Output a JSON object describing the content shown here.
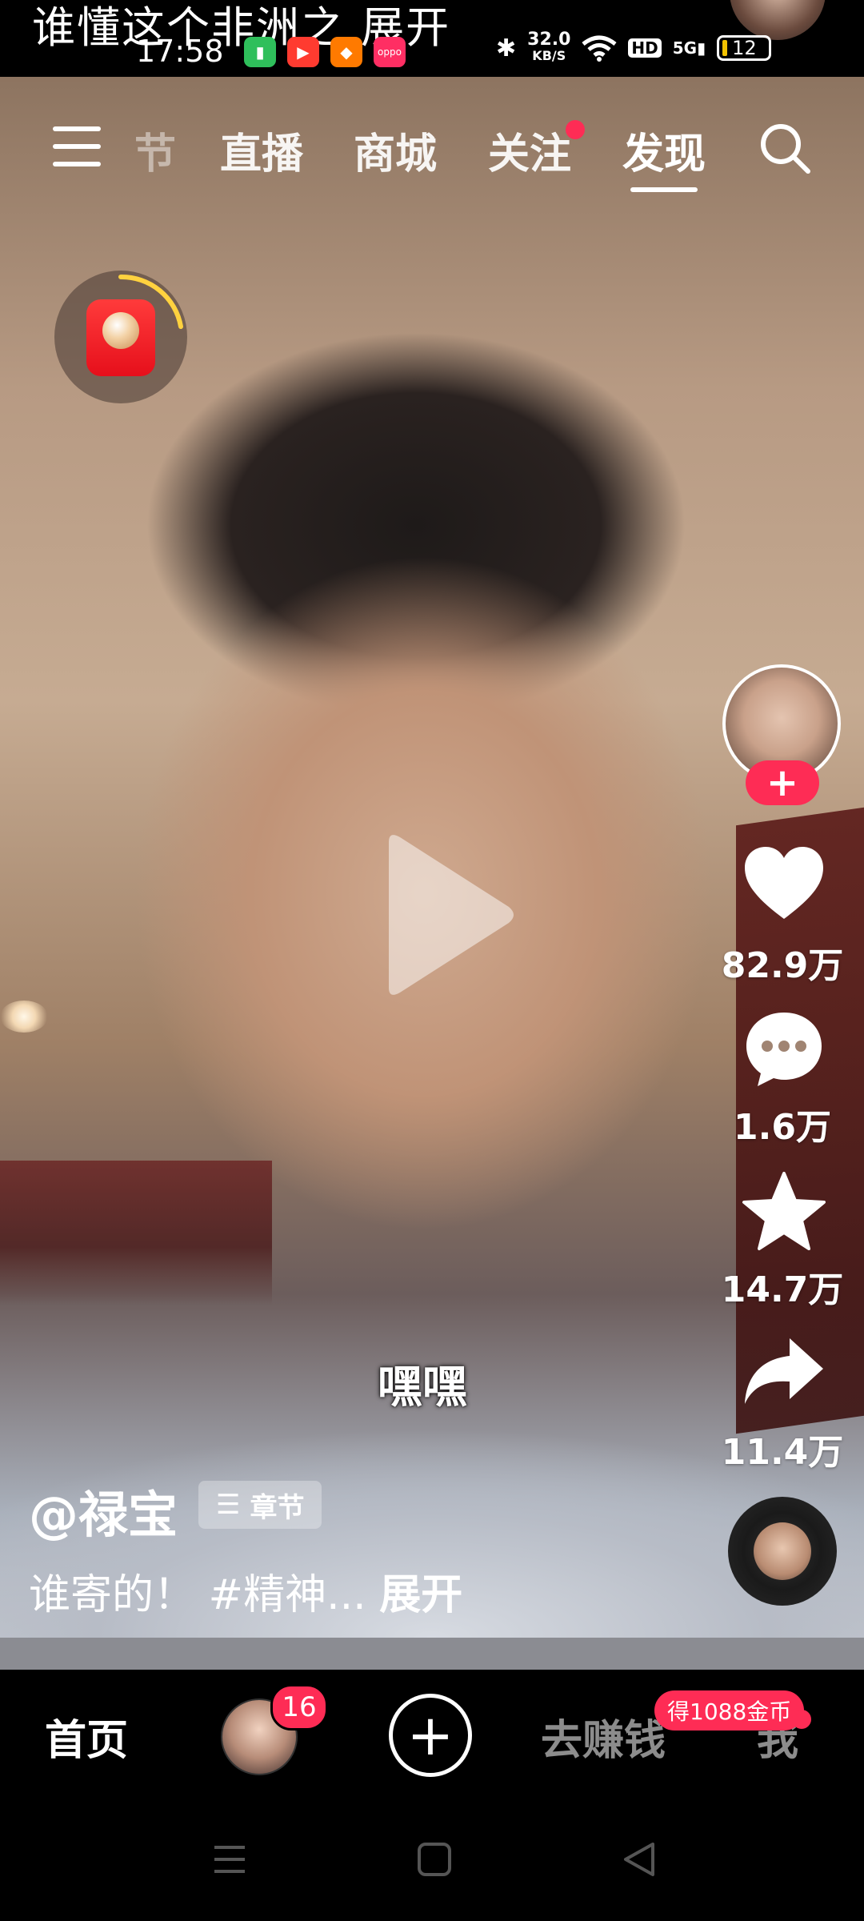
{
  "status_bar": {
    "notification_text": "谁懂这个非洲之    展开",
    "time": "17:58",
    "network_speed_value": "32.0",
    "network_speed_unit": "KB/S",
    "hd_label": "HD",
    "signal_label": "5G",
    "battery_level": "12"
  },
  "top_nav": {
    "faded_tab": "节",
    "tabs": [
      "直播",
      "商城",
      "关注",
      "发现"
    ],
    "active_tab": "发现"
  },
  "video": {
    "subtitle": "嘿嘿",
    "author": "@禄宝",
    "chapter_label": "章节",
    "description": "谁寄的！ #精神... ",
    "description_expand": "展开"
  },
  "actions": {
    "likes": "82.9万",
    "comments": "1.6万",
    "favorites": "14.7万",
    "shares": "11.4万"
  },
  "tab_bar": {
    "home": "首页",
    "friends_badge": "16",
    "earn": "去赚钱",
    "me": "我",
    "coin_badge": "得1088金币"
  },
  "colors": {
    "accent": "#fe2c55",
    "background": "#000000"
  }
}
